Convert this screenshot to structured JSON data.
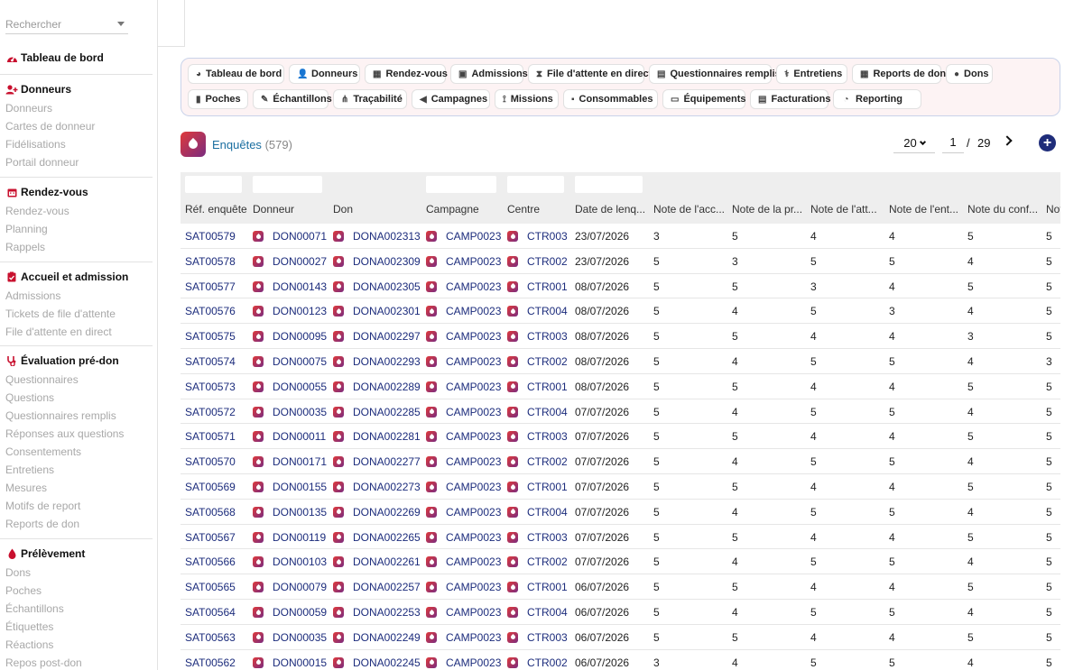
{
  "sidebar": {
    "search_placeholder": "Rechercher",
    "dashboard": "Tableau de bord",
    "sections": [
      {
        "title": "Donneurs",
        "icon": "user-plus-icon",
        "items": [
          "Donneurs",
          "Cartes de donneur",
          "Fidélisations",
          "Portail donneur"
        ]
      },
      {
        "title": "Rendez-vous",
        "icon": "calendar-icon",
        "items": [
          "Rendez-vous",
          "Planning",
          "Rappels"
        ]
      },
      {
        "title": "Accueil et admission",
        "icon": "clipboard-icon",
        "items": [
          "Admissions",
          "Tickets de file d'attente",
          "File d'attente en direct"
        ]
      },
      {
        "title": "Évaluation pré-don",
        "icon": "stethoscope-icon",
        "items": [
          "Questionnaires",
          "Questions",
          "Questionnaires remplis",
          "Réponses aux questions",
          "Consentements",
          "Entretiens",
          "Mesures",
          "Motifs de report",
          "Reports de don"
        ]
      },
      {
        "title": "Prélèvement",
        "icon": "blood-drop-icon",
        "items": [
          "Dons",
          "Poches",
          "Échantillons",
          "Étiquettes",
          "Réactions",
          "Repos post-don"
        ]
      }
    ]
  },
  "quicknav": {
    "row1": [
      {
        "label": "Tableau de bord",
        "icon": "dashboard-icon"
      },
      {
        "label": "Donneurs",
        "icon": "user-plus-icon"
      },
      {
        "label": "Rendez-vous",
        "icon": "calendar-icon"
      },
      {
        "label": "Admissions",
        "icon": "clipboard-icon"
      },
      {
        "label": "File d'attente en direct",
        "icon": "hourglass-icon"
      },
      {
        "label": "Questionnaires remplis",
        "icon": "form-icon"
      },
      {
        "label": "Entretiens",
        "icon": "stethoscope-icon"
      },
      {
        "label": "Reports de don",
        "icon": "calendar-x-icon"
      },
      {
        "label": "Dons",
        "icon": "blood-drop-icon"
      }
    ],
    "row2": [
      {
        "label": "Poches",
        "icon": "bag-icon"
      },
      {
        "label": "Échantillons",
        "icon": "syringe-icon"
      },
      {
        "label": "Traçabilité",
        "icon": "tree-icon"
      },
      {
        "label": "Campagnes",
        "icon": "megaphone-icon"
      },
      {
        "label": "Missions",
        "icon": "route-icon"
      },
      {
        "label": "Consommables",
        "icon": "boxes-icon"
      },
      {
        "label": "Équipements",
        "icon": "monitor-icon"
      },
      {
        "label": "Facturations",
        "icon": "invoice-icon"
      },
      {
        "label": "Reporting",
        "icon": "chart-pie-icon"
      }
    ]
  },
  "page": {
    "title": "Enquêtes",
    "count": "(579)"
  },
  "pager": {
    "page_size": "20",
    "current_page": "1",
    "separator": "/",
    "total_pages": "29"
  },
  "table": {
    "columns": [
      "Réf. enquête",
      "Donneur",
      "Don",
      "Campagne",
      "Centre",
      "Date de lenq...",
      "Note de l'acc...",
      "Note de la pr...",
      "Note de l'att...",
      "Note de l'ent...",
      "Note du conf...",
      "Not"
    ],
    "rows": [
      [
        "SAT00579",
        "DON00071",
        "DONA002313",
        "CAMP0023",
        "CTR003",
        "23/07/2026",
        "3",
        "5",
        "4",
        "4",
        "5",
        "5"
      ],
      [
        "SAT00578",
        "DON00027",
        "DONA002309",
        "CAMP0023",
        "CTR002",
        "23/07/2026",
        "5",
        "3",
        "5",
        "5",
        "4",
        "5"
      ],
      [
        "SAT00577",
        "DON00143",
        "DONA002305",
        "CAMP0023",
        "CTR001",
        "08/07/2026",
        "5",
        "5",
        "3",
        "4",
        "5",
        "5"
      ],
      [
        "SAT00576",
        "DON00123",
        "DONA002301",
        "CAMP0023",
        "CTR004",
        "08/07/2026",
        "5",
        "4",
        "5",
        "3",
        "4",
        "5"
      ],
      [
        "SAT00575",
        "DON00095",
        "DONA002297",
        "CAMP0023",
        "CTR003",
        "08/07/2026",
        "5",
        "5",
        "4",
        "4",
        "3",
        "5"
      ],
      [
        "SAT00574",
        "DON00075",
        "DONA002293",
        "CAMP0023",
        "CTR002",
        "08/07/2026",
        "5",
        "4",
        "5",
        "5",
        "4",
        "3"
      ],
      [
        "SAT00573",
        "DON00055",
        "DONA002289",
        "CAMP0023",
        "CTR001",
        "08/07/2026",
        "5",
        "5",
        "4",
        "4",
        "5",
        "5"
      ],
      [
        "SAT00572",
        "DON00035",
        "DONA002285",
        "CAMP0023",
        "CTR004",
        "07/07/2026",
        "5",
        "4",
        "5",
        "5",
        "4",
        "5"
      ],
      [
        "SAT00571",
        "DON00011",
        "DONA002281",
        "CAMP0023",
        "CTR003",
        "07/07/2026",
        "5",
        "5",
        "4",
        "4",
        "5",
        "5"
      ],
      [
        "SAT00570",
        "DON00171",
        "DONA002277",
        "CAMP0023",
        "CTR002",
        "07/07/2026",
        "5",
        "4",
        "5",
        "5",
        "4",
        "5"
      ],
      [
        "SAT00569",
        "DON00155",
        "DONA002273",
        "CAMP0023",
        "CTR001",
        "07/07/2026",
        "5",
        "5",
        "4",
        "4",
        "5",
        "5"
      ],
      [
        "SAT00568",
        "DON00135",
        "DONA002269",
        "CAMP0023",
        "CTR004",
        "07/07/2026",
        "5",
        "4",
        "5",
        "5",
        "4",
        "5"
      ],
      [
        "SAT00567",
        "DON00119",
        "DONA002265",
        "CAMP0023",
        "CTR003",
        "07/07/2026",
        "5",
        "5",
        "4",
        "4",
        "5",
        "5"
      ],
      [
        "SAT00566",
        "DON00103",
        "DONA002261",
        "CAMP0023",
        "CTR002",
        "07/07/2026",
        "5",
        "4",
        "5",
        "5",
        "4",
        "5"
      ],
      [
        "SAT00565",
        "DON00079",
        "DONA002257",
        "CAMP0023",
        "CTR001",
        "06/07/2026",
        "5",
        "5",
        "4",
        "4",
        "5",
        "5"
      ],
      [
        "SAT00564",
        "DON00059",
        "DONA002253",
        "CAMP0023",
        "CTR004",
        "06/07/2026",
        "5",
        "4",
        "5",
        "5",
        "4",
        "5"
      ],
      [
        "SAT00563",
        "DON00035",
        "DONA002249",
        "CAMP0023",
        "CTR003",
        "06/07/2026",
        "5",
        "5",
        "4",
        "4",
        "5",
        "5"
      ],
      [
        "SAT00562",
        "DON00015",
        "DONA002245",
        "CAMP0023",
        "CTR002",
        "06/07/2026",
        "3",
        "4",
        "5",
        "5",
        "4",
        "5"
      ]
    ]
  },
  "colors": {
    "accent": "#c8102e",
    "link": "#1c2c7c",
    "title": "#1a6ea0",
    "panel_bg": "#fdf3f4",
    "panel_border": "#c9d3ea"
  }
}
